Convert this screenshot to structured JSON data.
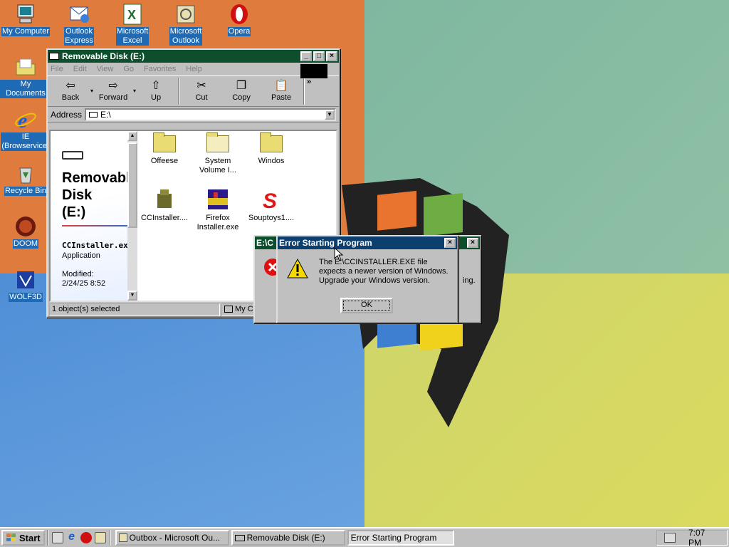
{
  "desktop": {
    "icons": [
      {
        "label": [
          "My Computer"
        ],
        "icon": "computer-icon"
      },
      {
        "label": [
          "Outlook",
          "Express"
        ],
        "icon": "outlook-express-icon"
      },
      {
        "label": [
          "Microsoft",
          "Excel"
        ],
        "icon": "excel-icon"
      },
      {
        "label": [
          "Microsoft",
          "Outlook"
        ],
        "icon": "outlook-icon"
      },
      {
        "label": [
          "Opera"
        ],
        "icon": "opera-icon"
      },
      {
        "label": [
          "My Documents"
        ],
        "icon": "folder-icon"
      },
      {
        "label": [
          "IE",
          "(Browservice)"
        ],
        "icon": "internet-explorer-icon"
      },
      {
        "label": [
          "Recycle Bin"
        ],
        "icon": "recycle-bin-icon"
      },
      {
        "label": [
          "DOOM"
        ],
        "icon": "doom-icon"
      },
      {
        "label": [
          "WOLF3D"
        ],
        "icon": "wolf3d-icon"
      }
    ]
  },
  "explorer": {
    "title": "Removable Disk (E:)",
    "menu": [
      "File",
      "Edit",
      "View",
      "Go",
      "Favorites",
      "Help"
    ],
    "toolbar": {
      "back": "Back",
      "forward": "Forward",
      "up": "Up",
      "cut": "Cut",
      "copy": "Copy",
      "paste": "Paste",
      "more": "»"
    },
    "address_label": "Address",
    "address_value": "E:\\",
    "panel": {
      "title_line1": "Removable",
      "title_line2": "Disk",
      "title_line3": "(E:)",
      "file_name": "CCInstaller.exe",
      "file_type": "Application",
      "modified_label": "Modified:",
      "modified_value": "2/24/25 8:52"
    },
    "files": [
      {
        "name": [
          "Offeese"
        ],
        "type": "folder"
      },
      {
        "name": [
          "System",
          "Volume I..."
        ],
        "type": "folder-light"
      },
      {
        "name": [
          "Windos"
        ],
        "type": "folder"
      },
      {
        "name": [
          "CCInstaller...."
        ],
        "type": "installer"
      },
      {
        "name": [
          "Firefox",
          "Installer.exe"
        ],
        "type": "firefox-installer"
      },
      {
        "name": [
          "Souptoys1...."
        ],
        "type": "souptoys"
      }
    ],
    "status_left": "1 object(s) selected",
    "status_right": "My C"
  },
  "dialog_back": {
    "title": "E:\\C",
    "partial_text": "ing."
  },
  "dialog": {
    "title": "Error Starting Program",
    "message_lines": [
      "The E:\\CCINSTALLER.EXE file",
      "expects a newer version of Windows.",
      "Upgrade your Windows version."
    ],
    "ok": "OK"
  },
  "taskbar": {
    "start": "Start",
    "tasks": [
      "Outbox - Microsoft Ou...",
      "Removable Disk (E:)",
      "Error Starting Program"
    ],
    "time": "7:07 PM"
  },
  "colors": {
    "title_active": "#0a246a",
    "title_green": "#0d4f2c",
    "desktop_label_bg": "#1e6ab5"
  }
}
